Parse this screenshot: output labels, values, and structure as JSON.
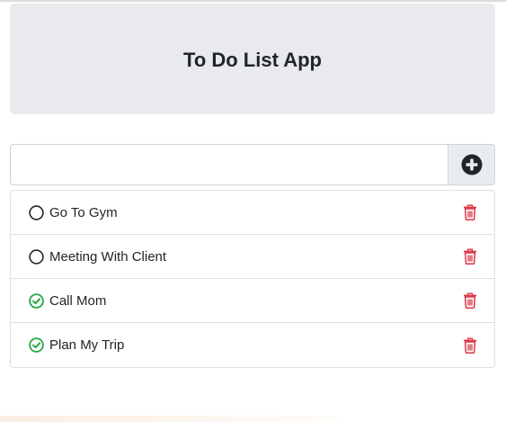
{
  "header": {
    "title": "To Do List App"
  },
  "new_task": {
    "value": "",
    "placeholder": ""
  },
  "add_button": {
    "icon": "plus-circle-icon"
  },
  "tasks": [
    {
      "label": "Go To Gym",
      "done": false
    },
    {
      "label": "Meeting With Client",
      "done": false
    },
    {
      "label": "Call Mom",
      "done": true
    },
    {
      "label": "Plan My Trip",
      "done": true
    }
  ],
  "colors": {
    "header_bg": "#e9eaee",
    "done_check": "#28a745",
    "trash": "#dc3545",
    "add_icon": "#212529"
  }
}
